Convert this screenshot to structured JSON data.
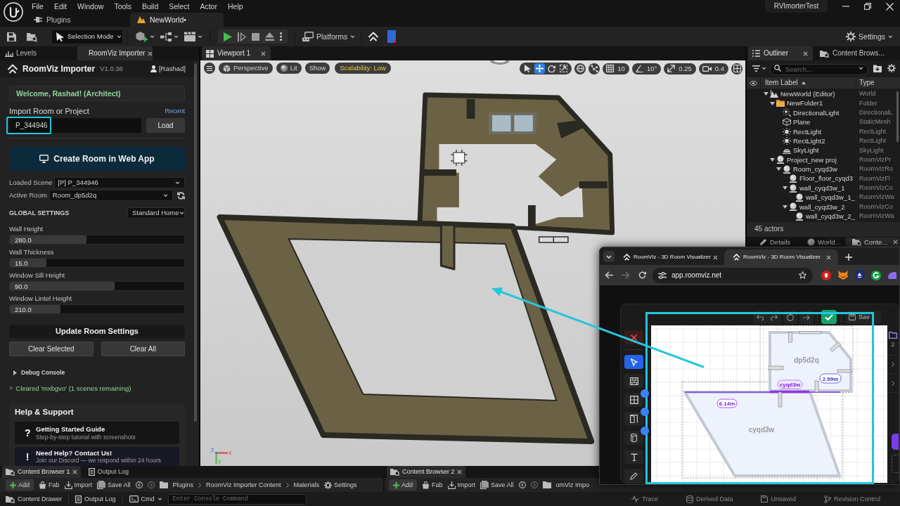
{
  "title_bar": {
    "menus": [
      "File",
      "Edit",
      "Window",
      "Tools",
      "Build",
      "Select",
      "Actor",
      "Help"
    ],
    "project": "RVImorterTest"
  },
  "document_tabs": [
    {
      "label": "Plugins",
      "kind": "plugins",
      "selected": false
    },
    {
      "label": "NewWorld•",
      "kind": "level",
      "selected": true
    }
  ],
  "toolbar": {
    "mode": "Selection Mode",
    "platforms": "Platforms",
    "settings": "Settings"
  },
  "left_panel": {
    "tabs": [
      {
        "label": "Levels",
        "kind": "levels",
        "selected": false
      },
      {
        "label": "RoomViz Importer",
        "kind": "plugin",
        "selected": true
      }
    ]
  },
  "importer": {
    "title": "RoomViz Importer",
    "version": "V1.0.36",
    "user": "[Rashad]",
    "welcome": "Welcome, Rashad! (Architect)",
    "import_label": "Import Room or Project",
    "recent_link": "Recent",
    "import_field": {
      "value": "P_344946"
    },
    "load_button": "Load",
    "create_button": "Create Room in Web App",
    "loaded_scene": {
      "label": "Loaded Scene",
      "value": "[P] P_344946"
    },
    "active_room": {
      "label": "Active Room",
      "value": "Room_dp5d2q"
    },
    "global_settings": {
      "title": "GLOBAL SETTINGS",
      "preset": "Standard Home"
    },
    "sliders": [
      {
        "label": "Wall Height",
        "reading": "280.0",
        "level": 0.44
      },
      {
        "label": "Wall Thickness",
        "reading": "15.0",
        "level": 0.21
      },
      {
        "label": "Window Sill Height",
        "reading": "90.0",
        "level": 0.6
      },
      {
        "label": "Window Lintel Height",
        "reading": "210.0",
        "level": 0.29
      }
    ],
    "update_button": "Update Room Settings",
    "clear_buttons": [
      "Clear Selected",
      "Clear All"
    ],
    "debug_console": {
      "label": "Debug Console",
      "expanded": false
    },
    "log": [
      {
        "prompt": ">",
        "text": "Cleared 'mxbgvo' (1 scenes remaining)"
      }
    ],
    "help": {
      "title": "Help & Support",
      "cards": [
        {
          "mark": "?",
          "title": "Getting Started Guide",
          "subtitle": "Step-by-step tutorial with screenshots"
        },
        {
          "mark": "!",
          "title": "Need Help? Contact Us!",
          "subtitle": "Join our Discord — we respond within 24 hours"
        }
      ]
    }
  },
  "viewport": {
    "tab": "Viewport 1",
    "view": "Perspective",
    "lighting": "Lit",
    "show": "Show",
    "scalability": "Scalability: Low",
    "transform_tools": [
      {
        "kind": "select",
        "selected": false
      },
      {
        "kind": "move",
        "selected": true
      },
      {
        "kind": "rotate",
        "selected": false
      },
      {
        "kind": "scale",
        "selected": false
      }
    ],
    "snaps": [
      {
        "kind": "grid",
        "value": "10"
      },
      {
        "kind": "angle",
        "value": "10°"
      },
      {
        "kind": "scale",
        "value": "0.25"
      },
      {
        "kind": "camera",
        "value": "0.4"
      }
    ],
    "axis_labels": [
      "z",
      "x",
      "y"
    ]
  },
  "outliner": {
    "tabs": [
      {
        "label": "Outliner",
        "kind": "outliner",
        "selected": true
      },
      {
        "label": "Content Brows...",
        "kind": "content",
        "selected": false
      }
    ],
    "search_placeholder": "Search...",
    "columns": [
      {
        "label": "Item Label",
        "sorted": true
      },
      {
        "label": "Type",
        "sorted": false
      }
    ],
    "tree": [
      {
        "label": "NewWorld (Editor)",
        "type": "World",
        "kind": "world",
        "expanded": true,
        "children": [
          {
            "label": "NewFolder1",
            "type": "Folder",
            "kind": "folder",
            "expanded": true,
            "children": [
              {
                "label": "DirectionalLight",
                "type": "DirectionalL",
                "kind": "directional_light"
              },
              {
                "label": "Plane",
                "type": "StaticMesh",
                "kind": "static_mesh"
              },
              {
                "label": "RectLight",
                "type": "RectLight",
                "kind": "rect_light"
              },
              {
                "label": "RectLight2",
                "type": "RectLight",
                "kind": "rect_light"
              },
              {
                "label": "SkyLight",
                "type": "SkyLight",
                "kind": "sky_light"
              }
            ]
          },
          {
            "label": "Project_new proj",
            "type": "RoomVizPr",
            "kind": "actor",
            "expanded": true,
            "children": [
              {
                "label": "Room_cyqd3w",
                "type": "RoomVizRo",
                "kind": "actor",
                "expanded": true,
                "children": [
                  {
                    "label": "Floor_floor_cyqd3",
                    "type": "RoomVizFl",
                    "kind": "actor"
                  },
                  {
                    "label": "wall_cyqd3w_1",
                    "type": "RoomVizCo",
                    "kind": "actor",
                    "expanded": true,
                    "children": [
                      {
                        "label": "wall_cyqd3w_1_",
                        "type": "RoomVizWa",
                        "kind": "actor"
                      }
                    ]
                  },
                  {
                    "label": "wall_cyqd3w_2",
                    "type": "RoomVizCo",
                    "kind": "actor",
                    "expanded": true,
                    "children": [
                      {
                        "label": "wall_cyqd3w_2_",
                        "type": "RoomVizWa",
                        "kind": "actor"
                      }
                    ]
                  }
                ]
              }
            ]
          }
        ]
      }
    ],
    "actor_count": "45 actors",
    "lower_tabs": [
      {
        "label": "Details",
        "kind": "details",
        "selected": false
      },
      {
        "label": "World...",
        "kind": "world",
        "selected": false
      },
      {
        "label": "Conte...",
        "kind": "content",
        "selected": true
      }
    ]
  },
  "browser": {
    "tabs": [
      {
        "title": "RoomViz - 3D Room Visualizer",
        "selected": false
      },
      {
        "title": "RoomViz - 3D Room Visualizer",
        "selected": true
      }
    ],
    "url": "app.roomviz.net",
    "app": {
      "tools": [
        {
          "kind": "delete",
          "selected": false
        },
        {
          "kind": "select",
          "selected": true
        },
        {
          "kind": "wall",
          "selected": false
        },
        {
          "kind": "window",
          "selected": false
        },
        {
          "kind": "door",
          "selected": false
        },
        {
          "kind": "column",
          "selected": false
        },
        {
          "kind": "text",
          "selected": false
        },
        {
          "kind": "draw",
          "selected": false
        }
      ],
      "save": {
        "label": "Sav",
        "disabled": true
      },
      "plan": {
        "rooms": [
          "dp5d2q",
          "cyqd3w"
        ],
        "measurements": [
          "6.14m",
          "2.99m"
        ],
        "wall_tag": "cyqd3w"
      },
      "side_count": "2"
    }
  },
  "bottom_panels": [
    {
      "tabs": [
        {
          "label": "Content Browser 1",
          "kind": "content",
          "selected": true
        },
        {
          "label": "Output Log",
          "kind": "log",
          "selected": false
        }
      ],
      "actions": [
        {
          "kind": "add",
          "label": "Add"
        },
        {
          "kind": "fab",
          "label": "Fab"
        },
        {
          "kind": "import",
          "label": "Import"
        },
        {
          "kind": "save_all",
          "label": "Save All"
        }
      ],
      "path": [
        "Plugins",
        "RoomViz Importer Content",
        "Materials"
      ],
      "settings": "Settings"
    },
    {
      "tabs": [
        {
          "label": "Content Browser 2",
          "kind": "content",
          "selected": true
        }
      ],
      "actions": [
        {
          "kind": "add",
          "label": "Add"
        },
        {
          "kind": "fab",
          "label": "Fab"
        },
        {
          "kind": "import",
          "label": "Import"
        },
        {
          "kind": "save_all",
          "label": "Save All"
        }
      ],
      "path": [
        "omViz Impo"
      ]
    }
  ],
  "status_bar": {
    "content_drawer": "Content Drawer",
    "output_log": "Output Log",
    "cmd": "Cmd",
    "console_placeholder": "Enter Console Command",
    "indicators": [
      {
        "kind": "trace",
        "label": "Trace"
      },
      {
        "kind": "derived_data",
        "label": "Derived Data"
      },
      {
        "kind": "unsaved",
        "label": "Unsaved"
      },
      {
        "kind": "revision_control",
        "label": "Revision Control"
      }
    ]
  }
}
